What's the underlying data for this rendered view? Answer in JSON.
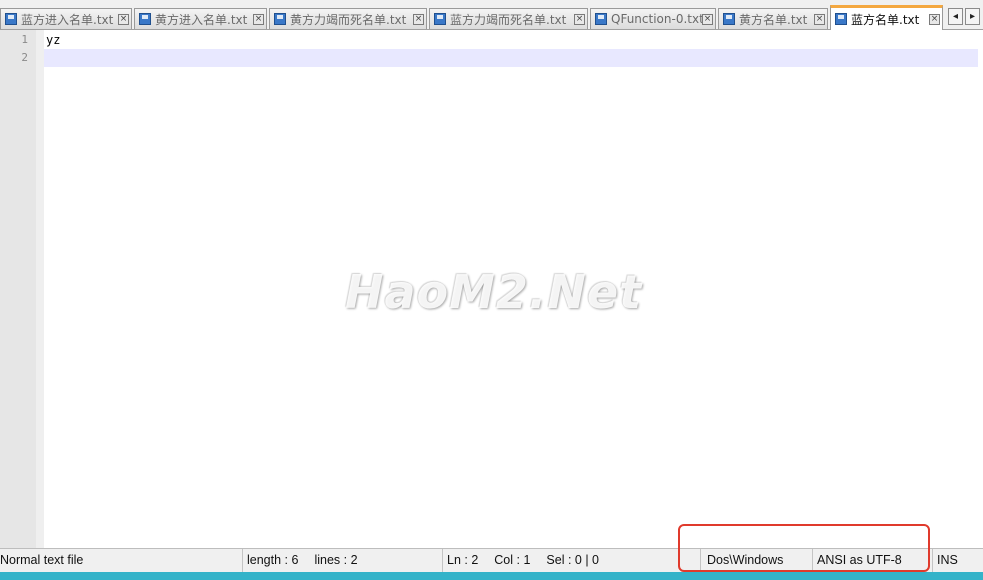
{
  "tabs": [
    {
      "label": "蓝方进入名单.txt",
      "active": false
    },
    {
      "label": "黄方进入名单.txt",
      "active": false
    },
    {
      "label": "黄方力竭而死名单.txt",
      "active": false
    },
    {
      "label": "蓝方力竭而死名单.txt",
      "active": false
    },
    {
      "label": "QFunction-0.txt",
      "active": false
    },
    {
      "label": "黄方名单.txt",
      "active": false
    },
    {
      "label": "蓝方名单.txt",
      "active": true
    }
  ],
  "tab_close_glyph": "×",
  "tab_scroll": {
    "left": "◂",
    "right": "▸"
  },
  "editor": {
    "line_numbers": [
      "1",
      "2"
    ],
    "lines": [
      "yz",
      ""
    ],
    "watermark": "HaoM2.Net"
  },
  "statusbar": {
    "file_type": "Normal text file",
    "length": "length : 6",
    "lines": "lines : 2",
    "ln": "Ln : 2",
    "col": "Col : 1",
    "sel": "Sel : 0 | 0",
    "eol": "Dos\\Windows",
    "encoding": "ANSI as UTF-8",
    "mode": "INS"
  },
  "colors": {
    "active_tab_accent": "#f4a840",
    "current_line": "#e8e8ff",
    "highlight_box": "#e03a2c",
    "taskbar": "#34b3c9"
  }
}
